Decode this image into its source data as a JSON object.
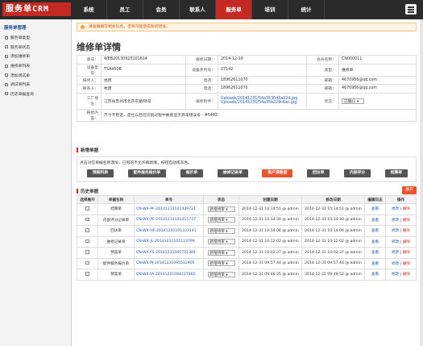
{
  "app": {
    "logo": "服务单CRM",
    "menu_icon": "hamburger-icon"
  },
  "nav": [
    "系统",
    "员工",
    "会员",
    "联系人",
    "服务单",
    "培训",
    "统计"
  ],
  "nav_active": 4,
  "sidebar": {
    "title": "服务单管理",
    "items": [
      "服务单类型",
      "服务单状态",
      "添加维修单",
      "维修单列表",
      "添加调试单",
      "调试单列表",
      "历史单据查询"
    ]
  },
  "notice": "请准确填写相关信息，否则可能造成系统错误。",
  "page_title": "维修单详情",
  "info": {
    "r1": {
      "k1": "单号：",
      "v1": "WEB20130923101614",
      "k2": "报修日期：",
      "v2": "2014-12-16",
      "k3": "会员名称：",
      "v3": "CN000011"
    },
    "r2": {
      "k1": "设备型号：",
      "v1": "TSA450B",
      "k2": "设备序列号：",
      "v2": "07142",
      "k3": "类型：",
      "v3": "维修单"
    },
    "r3": {
      "k1": "报修人：",
      "v1": "杭周",
      "k2": "电话：",
      "v2": "18962611070",
      "k3": "邮箱：",
      "v3": "4670956@qq.com"
    },
    "r4": {
      "k1": "联系人：",
      "v1": "杭周",
      "k2": "电话：",
      "v2": "18962611070",
      "k3": "邮箱：",
      "v3": "4670956@qq.com"
    },
    "r5": {
      "k1": "工厂地址：",
      "v1": "江苏省苏州市北京东路68号",
      "k2": "报修附件：",
      "att1": "Uploads/20141231/54a3536d3a22d.jpg",
      "att2": "Uploads/20141231/54a35b229c6ac.jpg",
      "k3": "状态：",
      "v3": "已确认"
    },
    "r6": {
      "k1": "报修内容：",
      "v1": "尺寸不稳定，定位以后在切割过程中故意显示异常错误号：#5483"
    }
  },
  "new_section": {
    "title": "新增单据",
    "hint": "点击对应单据名称添加，已有的不允许再新增，按钮自动或灰色。",
    "buttons": [
      "预案列表",
      "配件服务报价单",
      "报价单",
      "维修记录单",
      "客户满意度",
      "回访单",
      "内部评分",
      "结算单"
    ]
  },
  "history": {
    "title": "历史单据",
    "expand": "展开",
    "headers": [
      "选择展开",
      "单据名称",
      "单号",
      "状态",
      "创建日期",
      "修改日期",
      "编辑日志",
      "操作"
    ],
    "rows": [
      {
        "name": "结算单",
        "code": "CN-WX-PF-20141231101439721",
        "status": "新增待审",
        "created": "2014-12-31 10:14:51 @ admin",
        "modified": "2014-12-31 10:14:51 @ admin",
        "log": "查看",
        "ops_edit": "修改",
        "ops_del": "删除"
      },
      {
        "name": "内部评分记录单",
        "code": "CN-WX-PF-20141231101415737",
        "status": "新增待审",
        "created": "2014-12-31 10:14:30 @ admin",
        "modified": "2014-12-31 10:14:30 @ admin",
        "log": "查看",
        "ops_edit": "修改",
        "ops_del": "删除"
      },
      {
        "name": "回访单",
        "code": "CN-WX-HF-20141231101333141",
        "status": "新增待审",
        "created": "2014-12-31 10:14:06 @ admin",
        "modified": "2014-12-31 10:14:06 @ admin",
        "log": "查看",
        "ops_edit": "修改",
        "ops_del": "删除"
      },
      {
        "name": "维修记录单",
        "code": "CN-WX-JL-20141231101113799",
        "status": "新增待审",
        "created": "2014-12-31 10:12:02 @ admin",
        "modified": "2014-12-31 10:12:02 @ admin",
        "log": "查看",
        "ops_edit": "修改",
        "ops_del": "删除"
      },
      {
        "name": "预案单",
        "code": "CN-WX-YS-20141231095722394",
        "status": "新增待审",
        "created": "2014-12-31 10:02:37 @ admin",
        "modified": "2014-12-31 10:02:37 @ admin",
        "log": "查看",
        "ops_edit": "修改",
        "ops_del": "删除"
      },
      {
        "name": "配件服务报价单",
        "code": "CN-WX-PJ-20141231095532405",
        "status": "新增待审",
        "created": "2014-12-31 09:57:44 @ admin",
        "modified": "2014-12-31 09:57:44 @ admin",
        "log": "查看",
        "ops_edit": "修改",
        "ops_del": "删除"
      },
      {
        "name": "预案单",
        "code": "CN-WX-YA-20141231094237460",
        "status": "新增待审",
        "created": "2014-12-31 09:46:35 @ admin",
        "modified": "2014-12-31 09:49:52 @ admin",
        "log": "查看",
        "ops_edit": "修改",
        "ops_del": "删除"
      }
    ]
  }
}
